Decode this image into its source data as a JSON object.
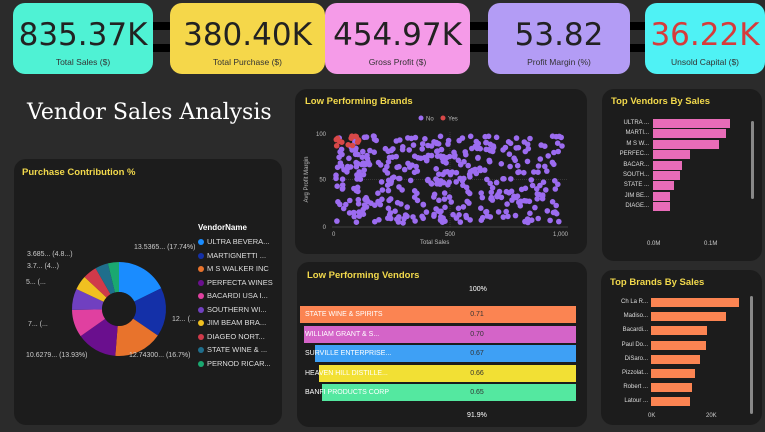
{
  "kpis": [
    {
      "value": "835.37K",
      "label": "Total Sales ($)",
      "bg": "#4ff2d4",
      "color": "#222"
    },
    {
      "value": "380.40K",
      "label": "Total Purchase ($)",
      "bg": "#f5d74a",
      "color": "#222"
    },
    {
      "value": "454.97K",
      "label": "Gross Profit ($)",
      "bg": "#f59be8",
      "color": "#222"
    },
    {
      "value": "53.82",
      "label": "Profit Margin (%)",
      "bg": "#b39cf5",
      "color": "#222"
    },
    {
      "value": "36.22K",
      "label": "Unsold Capital ($)",
      "bg": "#4ff2f5",
      "color": "#d63b3b"
    }
  ],
  "page_title": "Vendor Sales Analysis",
  "purchase_contribution": {
    "title": "Purchase Contribution %",
    "legend_title": "VendorName",
    "slice_labels": [
      "13.5365... (17.74%)",
      "12... (...",
      "12.74300... (16.7%)",
      "10.6279... (13.93%)",
      "7... (...",
      "5... (...",
      "3.7... (4...)",
      "3.685... (4.8...)"
    ],
    "legend": [
      {
        "name": "ULTRA BEVERA...",
        "color": "#1a8cff"
      },
      {
        "name": "MARTIGNETTI ...",
        "color": "#1430a8"
      },
      {
        "name": "M S WALKER INC",
        "color": "#e8732c"
      },
      {
        "name": "PERFECTA WINES",
        "color": "#6a0f8e"
      },
      {
        "name": "BACARDI USA I...",
        "color": "#e040a0"
      },
      {
        "name": "SOUTHERN WI...",
        "color": "#7040c0"
      },
      {
        "name": "JIM BEAM BRA...",
        "color": "#f0c020"
      },
      {
        "name": "DIAGEO NORT...",
        "color": "#d03a4a"
      },
      {
        "name": "STATE WINE & ...",
        "color": "#1f6e8c"
      },
      {
        "name": "PERNOD RICAR...",
        "color": "#1aa870"
      }
    ]
  },
  "low_brands": {
    "title": "Low Performing Brands",
    "legend": [
      {
        "name": "No",
        "color": "#9c6cf0"
      },
      {
        "name": "Yes",
        "color": "#d84848"
      }
    ],
    "xlabel": "Total Sales",
    "ylabel": "Avg Profit Margin",
    "xticks": [
      "0",
      "500",
      "1,000"
    ],
    "yticks": [
      "0",
      "50",
      "100"
    ]
  },
  "top_vendors": {
    "title": "Top Vendors By Sales",
    "labels": [
      "ULTRA ...",
      "MARTI...",
      "M S W...",
      "PERFEC...",
      "BACAR...",
      "SOUTH...",
      "STATE ...",
      "JIM BE...",
      "DIAGE..."
    ],
    "values": [
      0.135,
      0.127,
      0.115,
      0.064,
      0.05,
      0.047,
      0.036,
      0.03,
      0.03
    ],
    "xticks": [
      "0.0M",
      "0.1M"
    ],
    "color": "#e86cb8"
  },
  "low_vendors": {
    "title": "Low Performing Vendors",
    "top_label": "100%",
    "bottom_label": "91.9%",
    "rows": [
      {
        "name": "STATE WINE & SPIRITS",
        "value": "0.71",
        "pct": 1.0,
        "color": "#fb8452"
      },
      {
        "name": "WILLIAM GRANT & S...",
        "value": "0.70",
        "pct": 0.985,
        "color": "#d464c8"
      },
      {
        "name": "SURVILLE ENTERPRISE...",
        "value": "0.67",
        "pct": 0.945,
        "color": "#3ea0f5"
      },
      {
        "name": "HEAVEN HILL DISTILLE...",
        "value": "0.66",
        "pct": 0.93,
        "color": "#f2e034"
      },
      {
        "name": "BANFI PRODUCTS CORP",
        "value": "0.65",
        "pct": 0.919,
        "color": "#54e8a0"
      }
    ]
  },
  "top_brands": {
    "title": "Top Brands By Sales",
    "labels": [
      "Ch La R...",
      "Madiso...",
      "Bacardi...",
      "Paul Do...",
      "DiSaro...",
      "Pizzolat...",
      "Robert ...",
      "Latour ..."
    ],
    "values": [
      28,
      24,
      18,
      17.5,
      15.5,
      14,
      13,
      12.5
    ],
    "xticks": [
      "0K",
      "20K"
    ],
    "color": "#fb8452"
  },
  "chart_data": [
    {
      "type": "pie",
      "title": "Purchase Contribution %",
      "categories": [
        "ULTRA BEVERA...",
        "MARTIGNETTI ...",
        "M S WALKER INC",
        "PERFECTA WINES",
        "BACARDI USA I...",
        "SOUTHERN WI...",
        "JIM BEAM BRA...",
        "DIAGEO NORT...",
        "STATE WINE & ...",
        "PERNOD RICAR..."
      ],
      "values": [
        17.74,
        16.8,
        16.7,
        13.93,
        9.5,
        7.3,
        4.9,
        4.8,
        4.5,
        3.8
      ]
    },
    {
      "type": "scatter",
      "title": "Low Performing Brands",
      "xlabel": "Total Sales",
      "ylabel": "Avg Profit Margin",
      "xlim": [
        0,
        1000
      ],
      "ylim": [
        0,
        100
      ],
      "series": [
        {
          "name": "No"
        },
        {
          "name": "Yes"
        }
      ]
    },
    {
      "type": "bar",
      "title": "Top Vendors By Sales",
      "categories": [
        "ULTRA ...",
        "MARTI...",
        "M S W...",
        "PERFEC...",
        "BACAR...",
        "SOUTH...",
        "STATE ...",
        "JIM BE...",
        "DIAGE..."
      ],
      "values": [
        0.135,
        0.127,
        0.115,
        0.064,
        0.05,
        0.047,
        0.036,
        0.03,
        0.03
      ]
    },
    {
      "type": "bar",
      "title": "Low Performing Vendors",
      "categories": [
        "STATE WINE & SPIRITS",
        "WILLIAM GRANT & S...",
        "SURVILLE ENTERPRISE...",
        "HEAVEN HILL DISTILLE...",
        "BANFI PRODUCTS CORP"
      ],
      "values": [
        0.71,
        0.7,
        0.67,
        0.66,
        0.65
      ]
    },
    {
      "type": "bar",
      "title": "Top Brands By Sales",
      "categories": [
        "Ch La R...",
        "Madiso...",
        "Bacardi...",
        "Paul Do...",
        "DiSaro...",
        "Pizzolat...",
        "Robert ...",
        "Latour ..."
      ],
      "values": [
        28,
        24,
        18,
        17.5,
        15.5,
        14,
        13,
        12.5
      ]
    }
  ]
}
